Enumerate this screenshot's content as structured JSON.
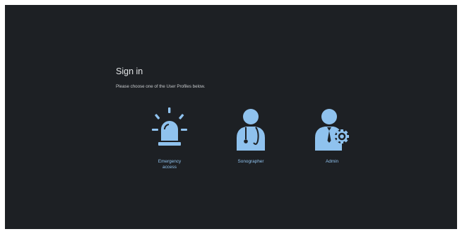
{
  "signin": {
    "title": "Sign in",
    "subtitle": "Please choose one of the User Profiles below."
  },
  "profiles": [
    {
      "id": "emergency",
      "label_line1": "Emergency",
      "label_line2": "access",
      "icon": "siren-icon"
    },
    {
      "id": "sonographer",
      "label_line1": "Sonographer",
      "label_line2": "",
      "icon": "doctor-stethoscope-icon"
    },
    {
      "id": "admin",
      "label_line1": "Admin",
      "label_line2": "",
      "icon": "user-gear-icon"
    }
  ],
  "colors": {
    "background": "#1d2024",
    "icon": "#8fc2ee",
    "title_text": "#e4e6e8"
  }
}
